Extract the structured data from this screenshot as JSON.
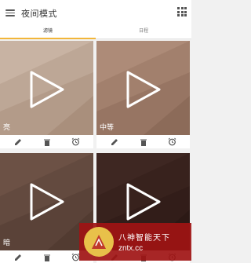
{
  "appbar": {
    "title": "夜间模式",
    "menu_icon": "menu-icon",
    "grid_icon": "grid-icon"
  },
  "tabs": [
    {
      "label": "滤镜",
      "active": true
    },
    {
      "label": "日程",
      "active": false
    }
  ],
  "cards": [
    {
      "label": "亮",
      "color": "#c8b3a3"
    },
    {
      "label": "中等",
      "color": "#a98774"
    },
    {
      "label": "暗",
      "color": "#6a5044"
    },
    {
      "label": "",
      "color": "#3c2520"
    }
  ],
  "card_actions": [
    "edit-icon",
    "delete-icon",
    "alarm-icon"
  ],
  "watermark": {
    "title": "八神智能天下",
    "url": "zntx.cc"
  }
}
